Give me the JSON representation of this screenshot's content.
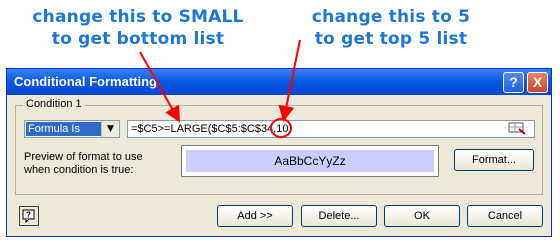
{
  "annotations": {
    "left": [
      "change this to SMALL",
      "to get bottom list"
    ],
    "right": [
      "change this to 5",
      "to get top 5 list"
    ],
    "color": "#1f77d4"
  },
  "dialog": {
    "title": "Conditional Formatting",
    "help_glyph": "?",
    "close_glyph": "X",
    "condition_label": "Condition 1",
    "condition_type": "Formula Is",
    "formula_value": "=$C5>=LARGE($C$5:$C$34,10)",
    "preview_label": [
      "Preview of format to use",
      "when condition is true:"
    ],
    "preview_text": "AaBbCcYyZz",
    "preview_fill": "#ccccff",
    "buttons": {
      "format": "Format...",
      "add": "Add >>",
      "delete": "Delete...",
      "ok": "OK",
      "cancel": "Cancel"
    },
    "icons": [
      "help-icon",
      "close-icon",
      "range-selector-icon",
      "dropdown-arrow-icon",
      "context-help-icon"
    ]
  }
}
